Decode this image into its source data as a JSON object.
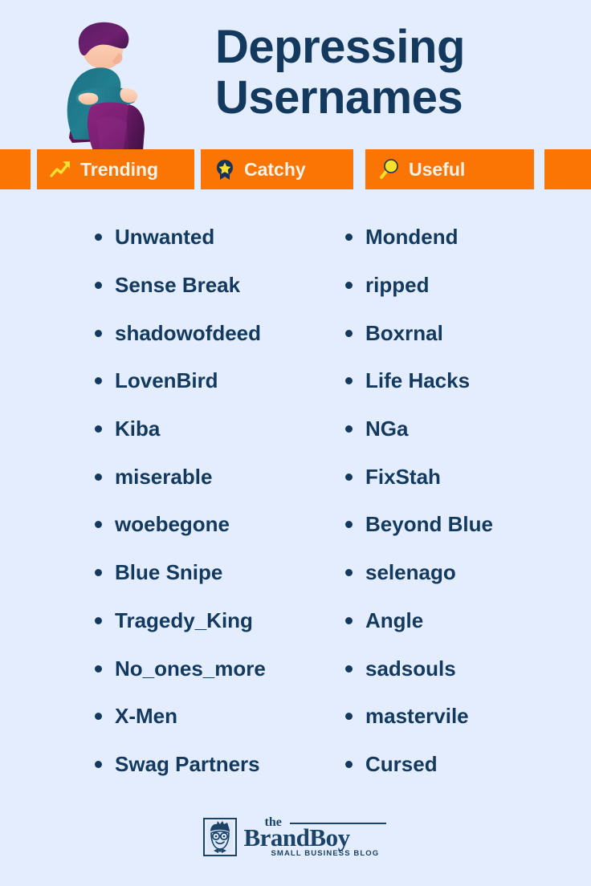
{
  "theme": {
    "background": "#e3edfd",
    "navy": "#133a5e",
    "orange": "#fb7504",
    "badge_text": "#fdf3ea",
    "yellow": "#f7e02e",
    "logo_navy": "#1b4368"
  },
  "header": {
    "title_line_1": "Depressing",
    "title_line_2": "Usernames",
    "illustration_name": "sad-person-hugging-knees-illustration"
  },
  "badges": [
    {
      "label": "",
      "icon": "",
      "name": "badge-stub-left"
    },
    {
      "label": "Trending",
      "icon": "trending-up-arrow-icon",
      "name": "badge-trending"
    },
    {
      "label": "Catchy",
      "icon": "award-ribbon-star-icon",
      "name": "badge-catchy"
    },
    {
      "label": "Useful",
      "icon": "magnifying-glass-icon",
      "name": "badge-useful"
    },
    {
      "label": "",
      "icon": "",
      "name": "badge-stub-right"
    }
  ],
  "lists": {
    "left_column": [
      "Unwanted",
      "Sense Break",
      "shadowofdeed",
      "LovenBird",
      "Kiba",
      "miserable",
      "woebegone",
      "Blue Snipe",
      "Tragedy_King",
      "No_ones_more",
      "X-Men",
      "Swag Partners"
    ],
    "right_column": [
      "Mondend",
      "ripped",
      "Boxrnal",
      "Life Hacks",
      "NGa",
      "FixStah",
      "Beyond Blue",
      "selenago",
      "Angle",
      "sadsouls",
      "mastervile",
      "Cursed"
    ]
  },
  "footer": {
    "logo_the": "the",
    "logo_name": "BrandBoy",
    "logo_tagline": "SMALL BUSINESS BLOG",
    "logo_mark_name": "boy-face-with-glasses-icon"
  }
}
